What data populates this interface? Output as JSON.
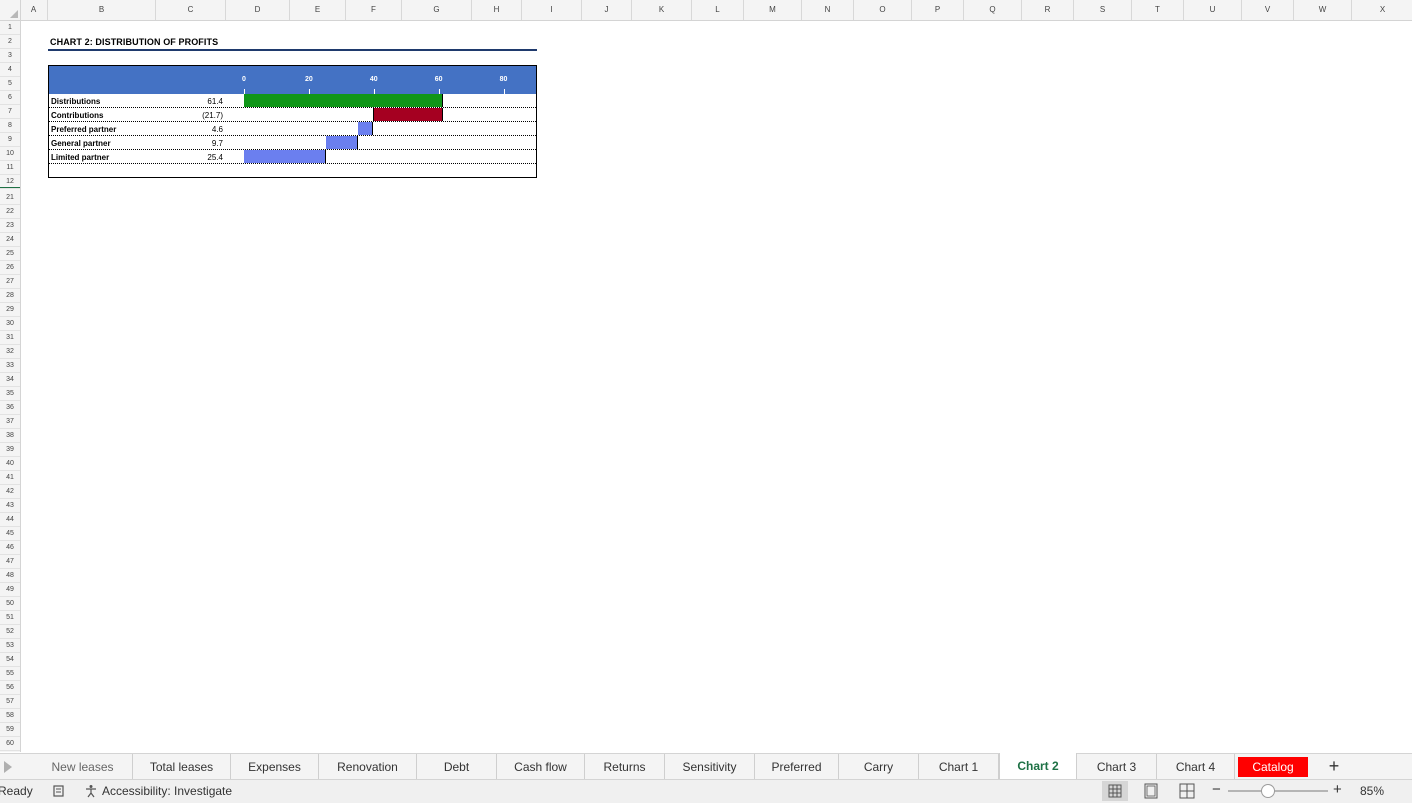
{
  "columns": [
    "A",
    "B",
    "C",
    "D",
    "E",
    "F",
    "G",
    "H",
    "I",
    "J",
    "K",
    "L",
    "M",
    "N",
    "O",
    "P",
    "Q",
    "R",
    "S",
    "T",
    "U",
    "V",
    "W",
    "X"
  ],
  "rows": [
    "1",
    "2",
    "3",
    "4",
    "5",
    "6",
    "7",
    "8",
    "9",
    "10",
    "11",
    "12",
    "21",
    "22",
    "23",
    "24",
    "25",
    "26",
    "27",
    "28",
    "29",
    "30",
    "31",
    "32",
    "33",
    "34",
    "35",
    "36",
    "37",
    "38",
    "39",
    "40",
    "41",
    "42",
    "43",
    "44",
    "45",
    "46",
    "47",
    "48",
    "49",
    "50",
    "51",
    "52",
    "53",
    "54",
    "55",
    "56",
    "57",
    "58",
    "59",
    "60"
  ],
  "sheet": {
    "title": "CHART 2: DISTRIBUTION OF PROFITS"
  },
  "chart_data": {
    "type": "bar",
    "subtype": "waterfall",
    "title": "CHART 2: DISTRIBUTION OF PROFITS",
    "axis_position": "top",
    "xlim": [
      0,
      90
    ],
    "ticks": [
      "0",
      "20",
      "40",
      "60",
      "80"
    ],
    "tick_values": [
      0,
      20,
      40,
      60,
      80
    ],
    "grid": false,
    "categories": [
      "Distributions",
      "Contributions",
      "Preferred partner",
      "General partner",
      "Limited partner"
    ],
    "labels": [
      "61.4",
      "(21.7)",
      "4.6",
      "9.7",
      "25.4"
    ],
    "values": [
      61.4,
      -21.7,
      4.6,
      9.7,
      25.4
    ],
    "bars": [
      {
        "start": 0,
        "end": 61.4,
        "color": "#109618"
      },
      {
        "start": 39.7,
        "end": 61.4,
        "color": "#a50021"
      },
      {
        "start": 35.1,
        "end": 39.7,
        "color": "#6b7fef"
      },
      {
        "start": 25.4,
        "end": 35.1,
        "color": "#6b7fef"
      },
      {
        "start": 0,
        "end": 25.4,
        "color": "#6b7fef"
      }
    ],
    "band_color": "#4472c4"
  },
  "tabs": [
    {
      "label": "New leases"
    },
    {
      "label": "Total leases"
    },
    {
      "label": "Expenses"
    },
    {
      "label": "Renovation"
    },
    {
      "label": "Debt"
    },
    {
      "label": "Cash flow"
    },
    {
      "label": "Returns"
    },
    {
      "label": "Sensitivity"
    },
    {
      "label": "Preferred"
    },
    {
      "label": "Carry"
    },
    {
      "label": "Chart 1"
    },
    {
      "label": "Chart 2",
      "active": true
    },
    {
      "label": "Chart 3"
    },
    {
      "label": "Chart 4"
    },
    {
      "label": "Catalog",
      "color": "#ff0000"
    }
  ],
  "add_tab_label": "+",
  "status": {
    "ready": "Ready",
    "accessibility": "Accessibility: Investigate",
    "zoom_minus": "−",
    "zoom_plus": "+",
    "zoom_level": "85%",
    "zoom_fraction": 0.4
  }
}
